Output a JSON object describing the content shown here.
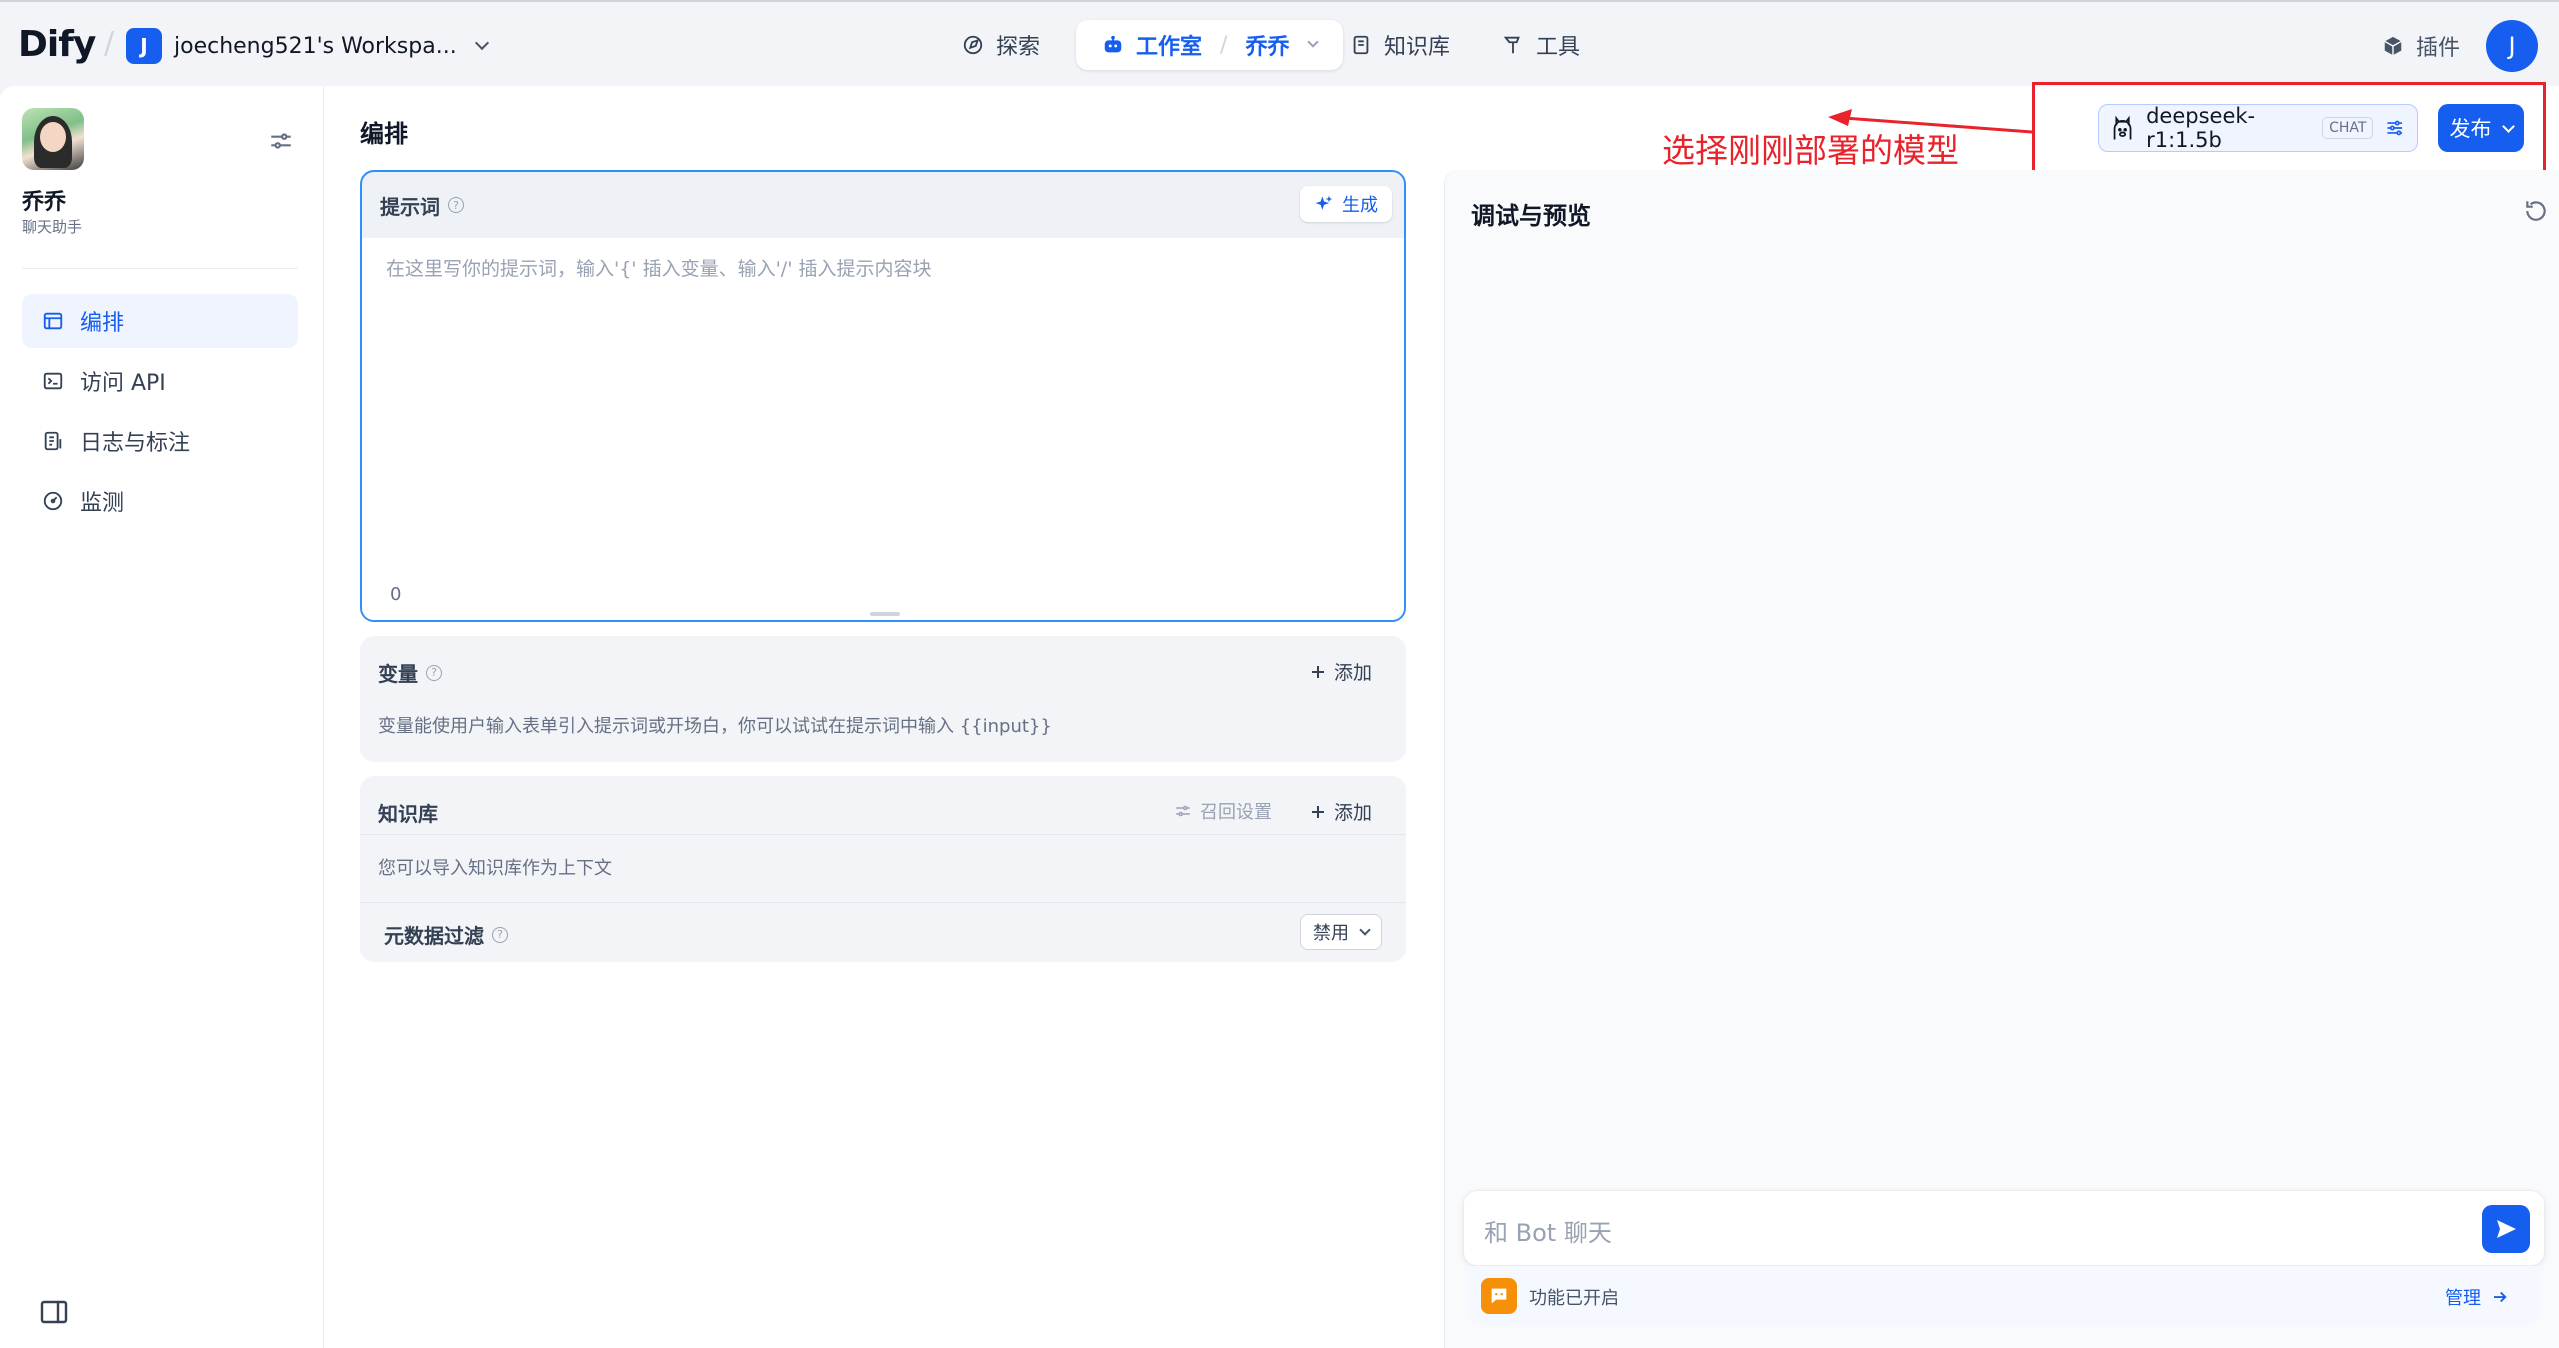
{
  "header": {
    "logo": "Dify",
    "workspace_initial": "J",
    "workspace_name": "joecheng521's Workspa...",
    "nav": {
      "explore": "探索",
      "studio": "工作室",
      "current_app": "乔乔",
      "knowledge": "知识库",
      "tools": "工具"
    },
    "plugins": "插件",
    "user_initial": "J"
  },
  "sidebar": {
    "app_name": "乔乔",
    "app_type": "聊天助手",
    "items": [
      {
        "label": "编排",
        "icon": "layout-icon",
        "active": true
      },
      {
        "label": "访问 API",
        "icon": "terminal-icon",
        "active": false
      },
      {
        "label": "日志与标注",
        "icon": "log-icon",
        "active": false
      },
      {
        "label": "监测",
        "icon": "gauge-icon",
        "active": false
      }
    ]
  },
  "main": {
    "title": "编排",
    "model": {
      "name": "deepseek-r1:1.5b",
      "badge": "CHAT"
    },
    "publish_label": "发布",
    "annotation": "选择刚刚部署的模型",
    "prompt": {
      "title": "提示词",
      "generate_label": "生成",
      "placeholder": "在这里写你的提示词，输入'{' 插入变量、输入'/' 插入提示内容块",
      "count": "0"
    },
    "variables": {
      "title": "变量",
      "add_label": "添加",
      "description": "变量能使用户输入表单引入提示词或开场白，你可以试试在提示词中输入 {{input}}"
    },
    "knowledge": {
      "title": "知识库",
      "recall_label": "召回设置",
      "add_label": "添加",
      "description": "您可以导入知识库作为上下文",
      "metadata_label": "元数据过滤",
      "metadata_value": "禁用"
    }
  },
  "debug": {
    "title": "调试与预览",
    "chat_placeholder": "和 Bot 聊天",
    "feature_text": "功能已开启",
    "manage_label": "管理"
  },
  "colors": {
    "accent": "#155eef",
    "annotation": "#e8232c",
    "focus_border": "#2e90fa"
  }
}
